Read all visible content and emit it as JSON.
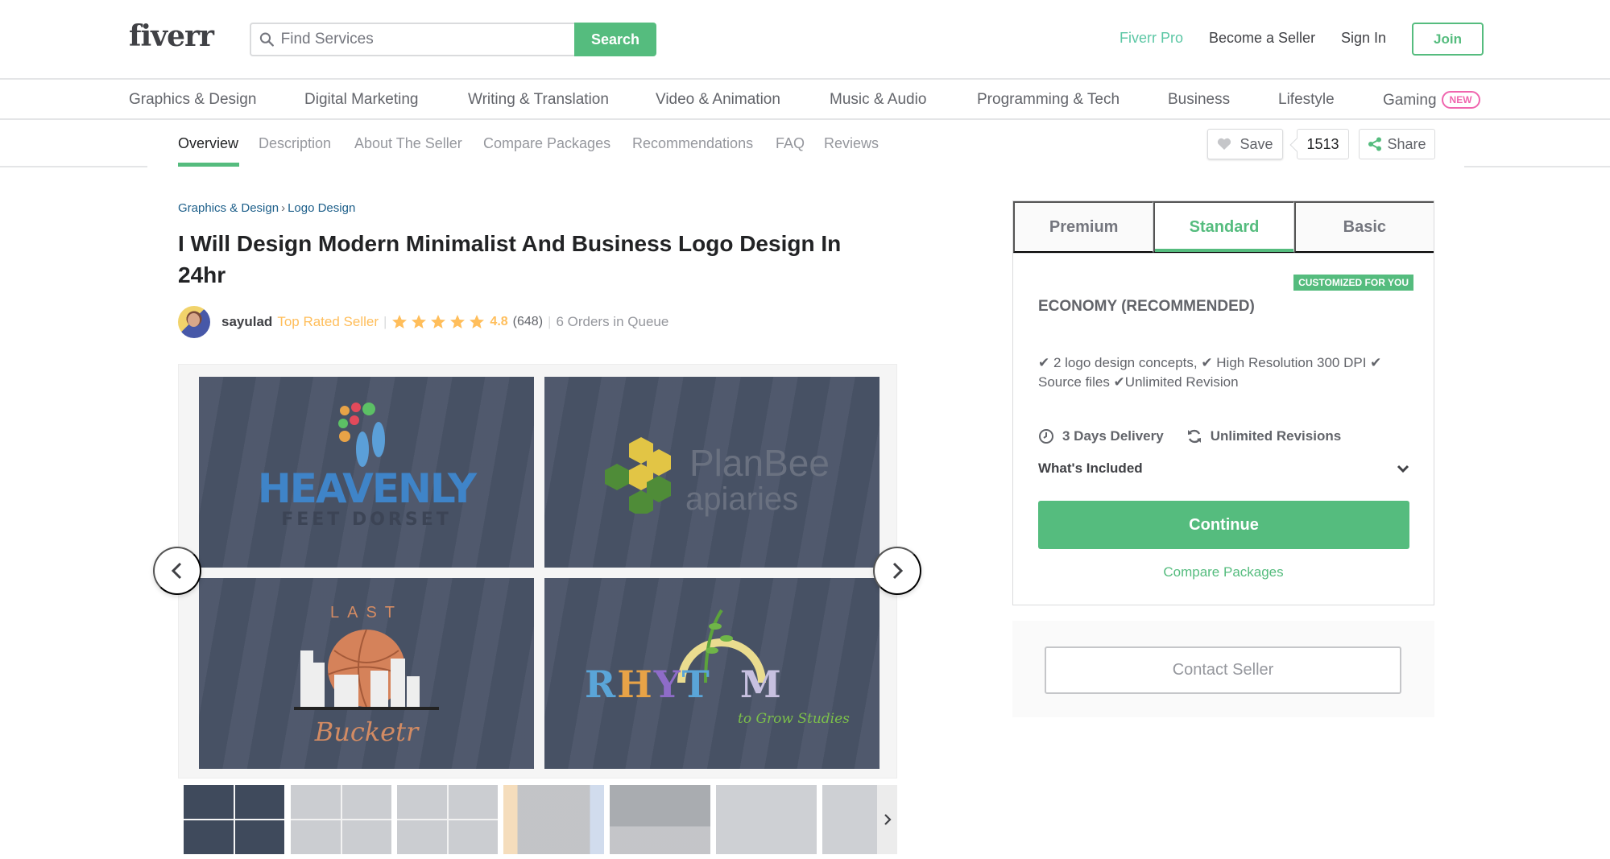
{
  "header": {
    "logo": "fiverr",
    "search_placeholder": "Find Services",
    "search_button": "Search",
    "links": {
      "fiverr_pro": "Fiverr Pro",
      "become_seller": "Become a Seller",
      "sign_in": "Sign In",
      "join": "Join"
    }
  },
  "categories": [
    {
      "label": "Graphics & Design"
    },
    {
      "label": "Digital Marketing"
    },
    {
      "label": "Writing & Translation"
    },
    {
      "label": "Video & Animation"
    },
    {
      "label": "Music & Audio"
    },
    {
      "label": "Programming & Tech"
    },
    {
      "label": "Business"
    },
    {
      "label": "Lifestyle"
    },
    {
      "label": "Gaming",
      "badge": "NEW"
    }
  ],
  "sub_nav": {
    "items": [
      {
        "label": "Overview",
        "active": true
      },
      {
        "label": "Description"
      },
      {
        "label": "About The Seller"
      },
      {
        "label": "Compare Packages"
      },
      {
        "label": "Recommendations"
      },
      {
        "label": "FAQ"
      },
      {
        "label": "Reviews"
      }
    ],
    "save_label": "Save",
    "save_count": "1513",
    "share_label": "Share"
  },
  "breadcrumb": {
    "items": [
      "Graphics & Design",
      "Logo Design"
    ],
    "separator": "›"
  },
  "gig": {
    "title": "I Will Design Modern Minimalist And Business Logo Design In 24hr",
    "seller": {
      "username": "sayulad",
      "level": "Top Rated Seller",
      "rating": "4.8",
      "stars": 5,
      "review_count": "(648)",
      "queue": "6 Orders in Queue"
    }
  },
  "gallery": {
    "tiles": [
      {
        "line1": "HEAVENLY",
        "line2": "FEET DORSET"
      },
      {
        "line1": "PlanBee",
        "line2": "apiaries"
      },
      {
        "line1": "LAST",
        "line2": "Bucketr"
      },
      {
        "line1": "RHYTHM",
        "line2": "to Grow Studies"
      }
    ],
    "thumbnail_count": 7
  },
  "package": {
    "tabs": [
      {
        "label": "Premium"
      },
      {
        "label": "Standard",
        "active": true
      },
      {
        "label": "Basic"
      }
    ],
    "badge": "CUSTOMIZED FOR YOU",
    "name": "ECONOMY (RECOMMENDED)",
    "description": "✔ 2 logo design concepts, ✔ High Resolution 300 DPI ✔ Source files ✔Unlimited Revision",
    "delivery": "3 Days Delivery",
    "revisions": "Unlimited Revisions",
    "whats_included": "What's Included",
    "continue": "Continue",
    "compare": "Compare Packages"
  },
  "contact": {
    "button": "Contact Seller"
  },
  "colors": {
    "brand_green": "#55bc7e",
    "pro_teal": "#5cc7a5",
    "star_yellow": "#ffbe5b",
    "new_pink": "#f065ae"
  }
}
